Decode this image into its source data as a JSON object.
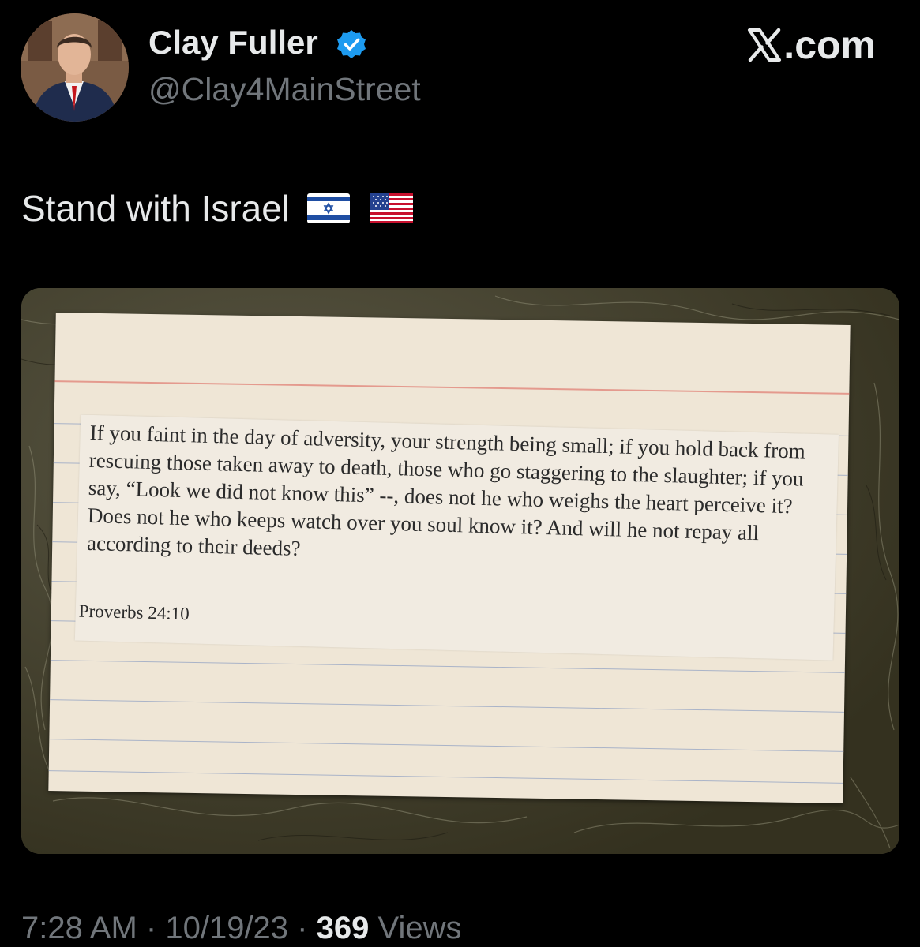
{
  "author": {
    "display_name": "Clay Fuller",
    "handle": "@Clay4MainStreet",
    "verified": true,
    "verified_color": "#1d9bf0"
  },
  "site": {
    "label": ".com"
  },
  "tweet": {
    "text": "Stand with Israel",
    "flags": [
      "flag-israel-icon",
      "flag-usa-icon"
    ]
  },
  "image": {
    "verse": "If you faint in the day of adversity, your strength being small; if you hold back from rescuing those taken away to death, those who go staggering to the slaughter; if you say, “Look we did not know this” --, does not he who weighs the heart perceive it?  Does not he who keeps watch over you soul know it?  And will he not repay all according to their deeds?",
    "reference": "Proverbs 24:10"
  },
  "meta": {
    "time": "7:28 AM",
    "date": "10/19/23",
    "separator": "·",
    "views_count": "369",
    "views_label": "Views"
  },
  "colors": {
    "background": "#000000",
    "text_primary": "#e7e9ea",
    "text_secondary": "#71767b"
  }
}
